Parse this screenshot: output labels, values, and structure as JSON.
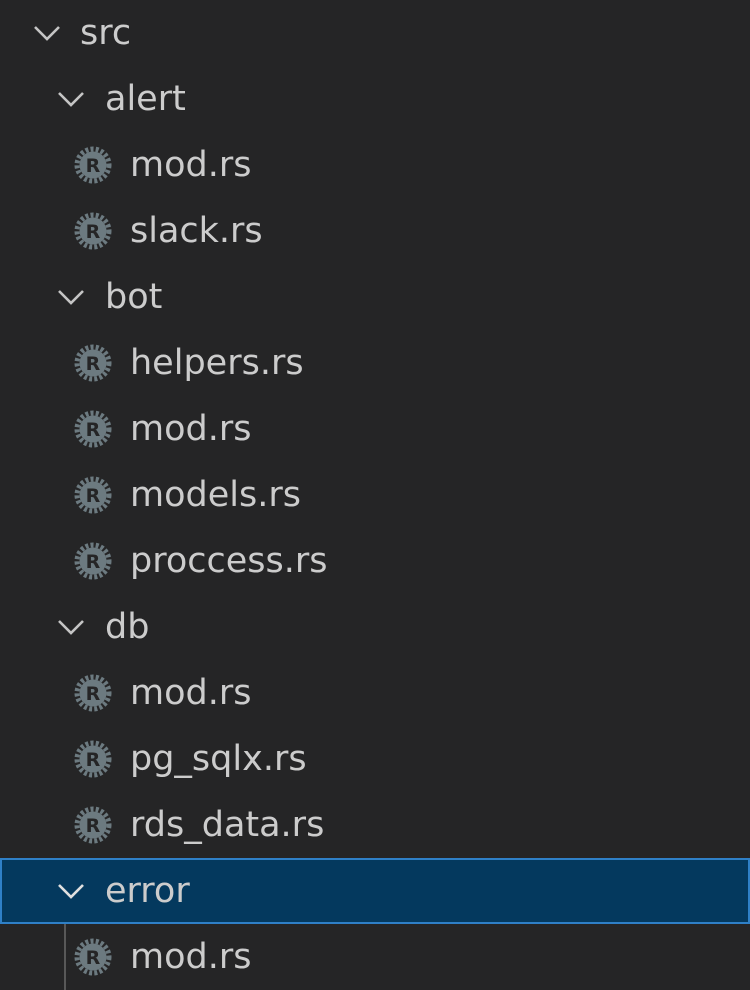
{
  "explorer": {
    "root": {
      "label": "src"
    },
    "folders": [
      {
        "label": "alert",
        "files": [
          "mod.rs",
          "slack.rs"
        ]
      },
      {
        "label": "bot",
        "files": [
          "helpers.rs",
          "mod.rs",
          "models.rs",
          "proccess.rs"
        ]
      },
      {
        "label": "db",
        "files": [
          "mod.rs",
          "pg_sqlx.rs",
          "rds_data.rs"
        ]
      },
      {
        "label": "error",
        "files": [
          "mod.rs"
        ]
      }
    ],
    "selected_folder": "error",
    "icons": {
      "folder_toggle": "chevron-down-icon",
      "file": "rust-file-icon"
    },
    "colors": {
      "background": "#252526",
      "text": "#cccccc",
      "selection_background": "#04395e",
      "selection_border": "#2f80c7",
      "file_icon": "#6c7a80"
    }
  }
}
